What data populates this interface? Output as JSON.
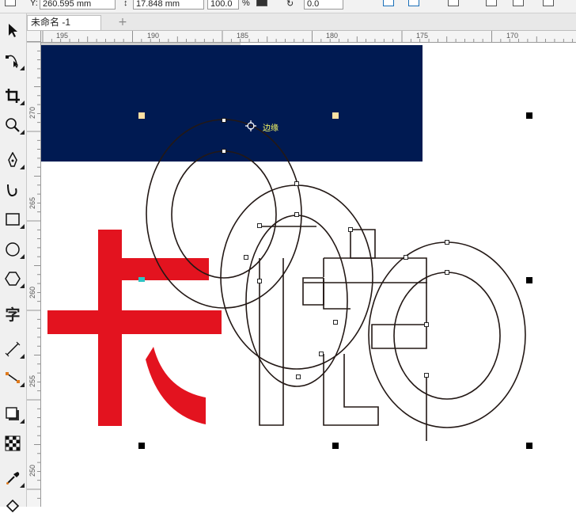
{
  "propbar": {
    "y_label": "Y:",
    "y_value": "260.595 mm",
    "height_value": "17.848 mm",
    "scale_value": "100.0",
    "scale_unit": "%",
    "angle_value": "0.0"
  },
  "tabs": [
    {
      "label": "未命名 -1",
      "active": true
    }
  ],
  "add_tab_label": "+",
  "hruler": {
    "labels": [
      "195",
      "190",
      "185",
      "180",
      "175",
      "170"
    ]
  },
  "vruler": {
    "labels": [
      "270",
      "265",
      "260",
      "255",
      "250"
    ]
  },
  "toolbox": {
    "items": [
      {
        "name": "pick-tool",
        "icon": "arrow-pointer-icon"
      },
      {
        "name": "shape-tool",
        "icon": "shape-node-icon"
      },
      {
        "name": "crop-tool",
        "icon": "crop-icon"
      },
      {
        "name": "zoom-tool",
        "icon": "magnifier-icon"
      },
      {
        "name": "pen-tool",
        "icon": "pen-nib-icon"
      },
      {
        "name": "artistic-media-tool",
        "icon": "brush-stroke-icon"
      },
      {
        "name": "rectangle-tool",
        "icon": "rectangle-icon"
      },
      {
        "name": "ellipse-tool",
        "icon": "ellipse-icon"
      },
      {
        "name": "polygon-tool",
        "icon": "hexagon-icon"
      },
      {
        "name": "text-tool",
        "icon": "text-icon",
        "glyph": "字"
      },
      {
        "name": "dimension-tool",
        "icon": "dimension-line-icon"
      },
      {
        "name": "connector-tool",
        "icon": "connector-icon"
      },
      {
        "name": "drop-shadow-tool",
        "icon": "drop-shadow-icon"
      },
      {
        "name": "transparency-tool",
        "icon": "checkerboard-icon"
      },
      {
        "name": "eyedropper-tool",
        "icon": "eyedropper-icon"
      },
      {
        "name": "fill-tool",
        "icon": "paint-bucket-icon"
      }
    ]
  },
  "canvas": {
    "snap_hint_label": "边缘",
    "colors": {
      "navy": "#001a52",
      "red": "#e3131f",
      "outline": "#231815",
      "handle": "#000000",
      "center_handle": "#ffe0a3",
      "node_cyan": "#2ec4c4"
    }
  }
}
